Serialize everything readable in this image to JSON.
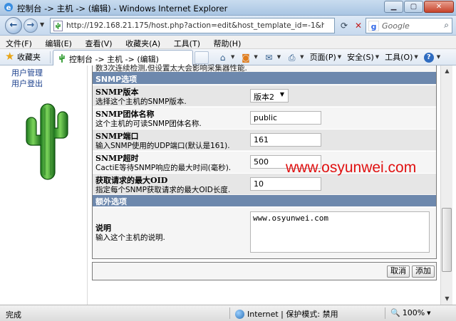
{
  "window": {
    "title": "控制台 -> 主机 -> (编辑) - Windows Internet Explorer"
  },
  "address": {
    "url": "http://192.168.21.175/host.php?action=edit&host_template_id=-1&host_status",
    "search_placeholder": "Google"
  },
  "menu": {
    "items": [
      "文件(F)",
      "编辑(E)",
      "查看(V)",
      "收藏夹(A)",
      "工具(T)",
      "帮助(H)"
    ]
  },
  "toolbar": {
    "favorites_label": "收藏夹",
    "tab_title": "控制台 -> 主机 -> (编辑)",
    "page_label": "页面(P)",
    "safety_label": "安全(S)",
    "tools_label": "工具(O)"
  },
  "leftnav": {
    "items": [
      "用户管理",
      "用户登出"
    ]
  },
  "form": {
    "cut_text": "数3次连续检测,但设置太大会影响采集器性能.",
    "snmp_section": "SNMP选项",
    "rows": [
      {
        "label": "SNMP版本",
        "desc": "选择这个主机的SNMP版本.",
        "value": "版本2"
      },
      {
        "label": "SNMP团体名称",
        "desc": "这个主机的可读SNMP团体名称.",
        "value": "public"
      },
      {
        "label": "SNMP端口",
        "desc": "输入SNMP使用的UDP端口(默认是161).",
        "value": "161"
      },
      {
        "label": "SNMP超时",
        "desc": "CactiE等待SNMP响应的最大时间(毫秒).",
        "value": "500"
      },
      {
        "label": "获取请求的最大OID",
        "desc": "指定每个SNMP获取请求的最大OID长度.",
        "value": "10"
      }
    ],
    "extra_section": "额外选项",
    "notes_label": "说明",
    "notes_desc": "输入这个主机的说明.",
    "notes_value": "www.osyunwei.com",
    "cancel_label": "取消",
    "add_label": "添加"
  },
  "watermark": "www.osyunwei.com",
  "status": {
    "left": "完成",
    "zone": "Internet | 保护模式: 禁用",
    "zoom": "100%"
  },
  "colors": {
    "section_header": "#6d88ad",
    "watermark": "#e01111",
    "link": "#1a3f8c"
  }
}
